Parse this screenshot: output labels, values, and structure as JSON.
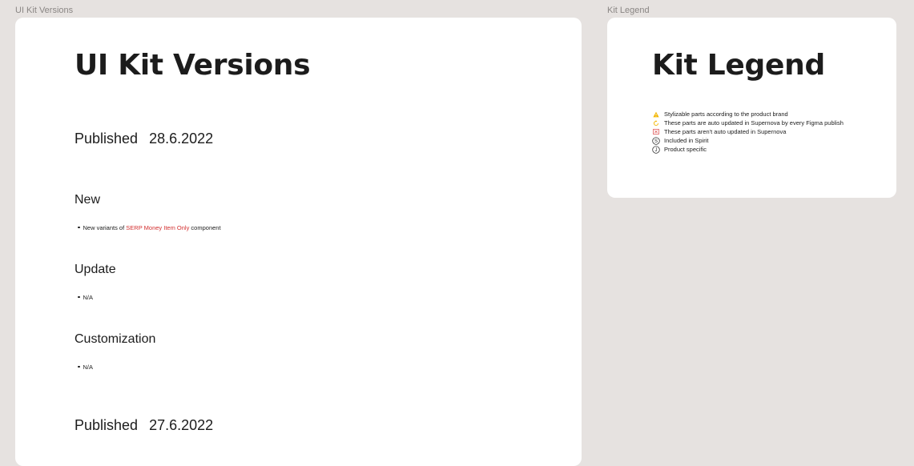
{
  "canvas": {
    "frame_labels": {
      "versions": "UI Kit Versions",
      "legend": "Kit Legend"
    }
  },
  "versions": {
    "title": "UI Kit Versions",
    "releases": [
      {
        "published_label": "Published",
        "date": "28.6.2022",
        "sections": [
          {
            "heading": "New",
            "items": [
              {
                "prefix": "New variants of ",
                "link": "SERP Money Item Only",
                "suffix": " component"
              }
            ]
          },
          {
            "heading": "Update",
            "items": [
              {
                "text": "N/A"
              }
            ]
          },
          {
            "heading": "Customization",
            "items": [
              {
                "text": "N/A"
              }
            ]
          }
        ]
      },
      {
        "published_label": "Published",
        "date": "27.6.2022"
      }
    ]
  },
  "legend": {
    "title": "Kit Legend",
    "items": [
      {
        "icon": "warning-triangle-icon",
        "color": "#f2b600",
        "text": "Stylizable parts according to the product brand"
      },
      {
        "icon": "refresh-icon",
        "color": "#f2b600",
        "text": "These parts are auto updated in Supernova by every Figma publish"
      },
      {
        "icon": "crossed-box-icon",
        "color": "#e05a5a",
        "text": "These parts aren't auto updated in Supernova"
      },
      {
        "icon": "circle-s-icon",
        "color": "#1c1c1c",
        "letter": "S",
        "text": "Included in Spirit"
      },
      {
        "icon": "circle-j-icon",
        "color": "#1c1c1c",
        "letter": "J",
        "text": "Product specific"
      }
    ]
  },
  "colors": {
    "canvas_bg": "#e6e2e0",
    "frame_bg": "#ffffff",
    "text": "#1c1c1c",
    "link": "#d32f2f",
    "label": "#8a8684"
  }
}
